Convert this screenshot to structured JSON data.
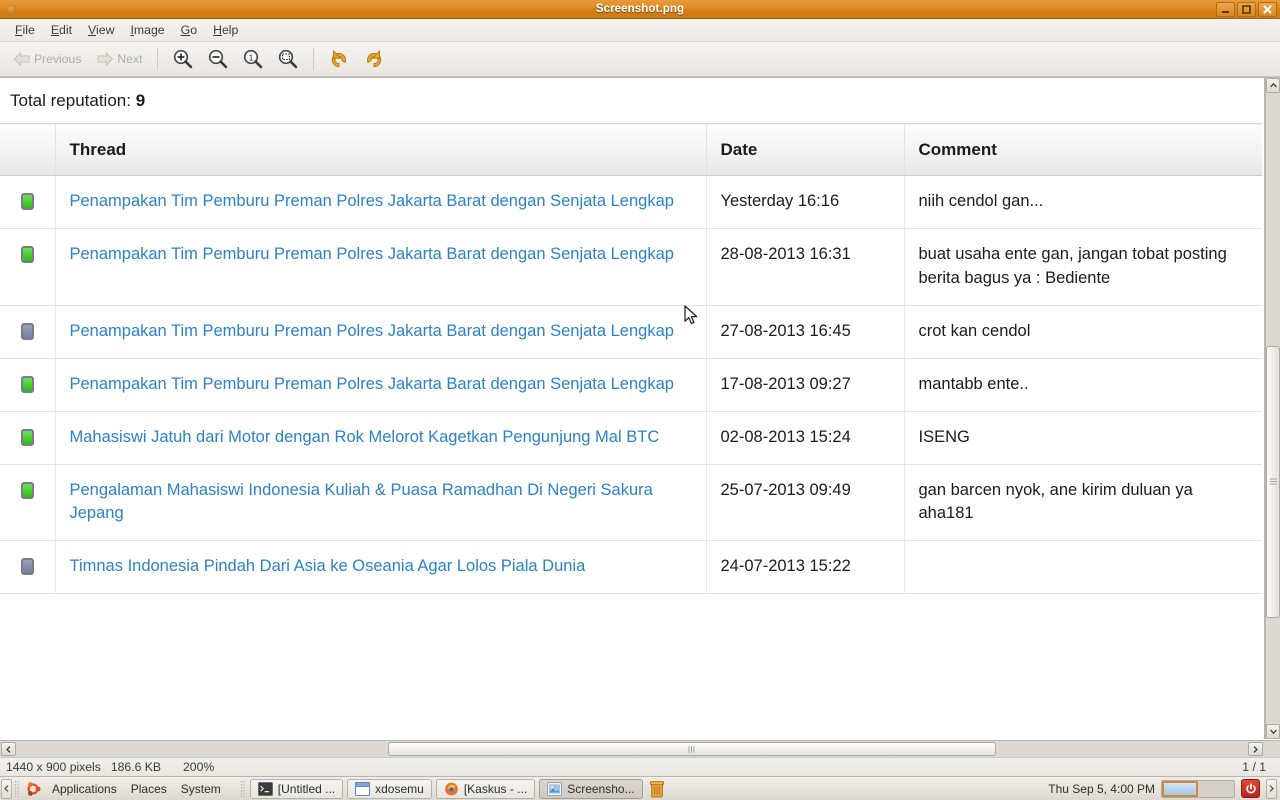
{
  "window": {
    "title": "Screenshot.png",
    "buttons": {
      "minimize": "minimize-button",
      "maximize": "maximize-button",
      "close": "close-button"
    }
  },
  "menubar": {
    "items": [
      {
        "label": "File",
        "mnemonic": "F"
      },
      {
        "label": "Edit",
        "mnemonic": "E"
      },
      {
        "label": "View",
        "mnemonic": "V"
      },
      {
        "label": "Image",
        "mnemonic": "I"
      },
      {
        "label": "Go",
        "mnemonic": "G"
      },
      {
        "label": "Help",
        "mnemonic": "H"
      }
    ]
  },
  "toolbar": {
    "previous_label": "Previous",
    "next_label": "Next",
    "zoom_in_label": "Zoom In",
    "zoom_out_label": "Zoom Out",
    "normal_size_label": "Normal Size",
    "best_fit_label": "Best Fit",
    "rotate_left_label": "Rotate Left",
    "rotate_right_label": "Rotate Right"
  },
  "content": {
    "total_reputation_label": "Total reputation:",
    "total_reputation_value": "9",
    "columns": [
      "Thread",
      "Date",
      "Comment"
    ],
    "rows": [
      {
        "status": "positive",
        "thread": "Penampakan Tim Pemburu Preman Polres Jakarta Barat dengan Senjata Lengkap",
        "date": "Yesterday 16:16",
        "comment": "niih cendol gan..."
      },
      {
        "status": "positive",
        "thread": "Penampakan Tim Pemburu Preman Polres Jakarta Barat dengan Senjata Lengkap",
        "date": "28-08-2013 16:31",
        "comment": "buat usaha ente gan, jangan tobat posting berita bagus ya : Bediente"
      },
      {
        "status": "neutral",
        "thread": "Penampakan Tim Pemburu Preman Polres Jakarta Barat dengan Senjata Lengkap",
        "date": "27-08-2013 16:45",
        "comment": "crot kan cendol"
      },
      {
        "status": "positive",
        "thread": "Penampakan Tim Pemburu Preman Polres Jakarta Barat dengan Senjata Lengkap",
        "date": "17-08-2013 09:27",
        "comment": "mantabb ente.."
      },
      {
        "status": "positive",
        "thread": "Mahasiswi Jatuh dari Motor dengan Rok Melorot Kagetkan Pengunjung Mal BTC",
        "date": "02-08-2013 15:24",
        "comment": "ISENG"
      },
      {
        "status": "positive",
        "thread": "Pengalaman Mahasiswi Indonesia Kuliah & Puasa Ramadhan Di Negeri Sakura Jepang",
        "date": "25-07-2013 09:49",
        "comment": "gan barcen nyok, ane kirim duluan ya aha181"
      },
      {
        "status": "neutral",
        "thread": "Timnas Indonesia Pindah Dari Asia ke Oseania Agar Lolos Piala Dunia",
        "date": "24-07-2013 15:22",
        "comment": ""
      }
    ]
  },
  "statusbar": {
    "dimensions": "1440 x 900 pixels",
    "filesize": "186.6 KB",
    "zoom": "200%",
    "page": "1 / 1"
  },
  "panel": {
    "menus": [
      "Applications",
      "Places",
      "System"
    ],
    "tasks": [
      {
        "label": "[Untitled ...",
        "icon": "terminal-icon",
        "active": false
      },
      {
        "label": "xdosemu",
        "icon": "window-icon",
        "active": false
      },
      {
        "label": "[Kaskus - ...",
        "icon": "firefox-icon",
        "active": false
      },
      {
        "label": "Screensho...",
        "icon": "image-viewer-icon",
        "active": true
      }
    ],
    "trash_label": "Trash",
    "clock": "Thu Sep  5,  4:00 PM",
    "workspaces": 2,
    "active_workspace": 1,
    "power_label": "Shut Down"
  },
  "colors": {
    "titlebar": "#dd8a22",
    "link": "#2b82c9",
    "positive": "#2dba17",
    "neutral": "#767d99",
    "power": "#b6231a"
  }
}
